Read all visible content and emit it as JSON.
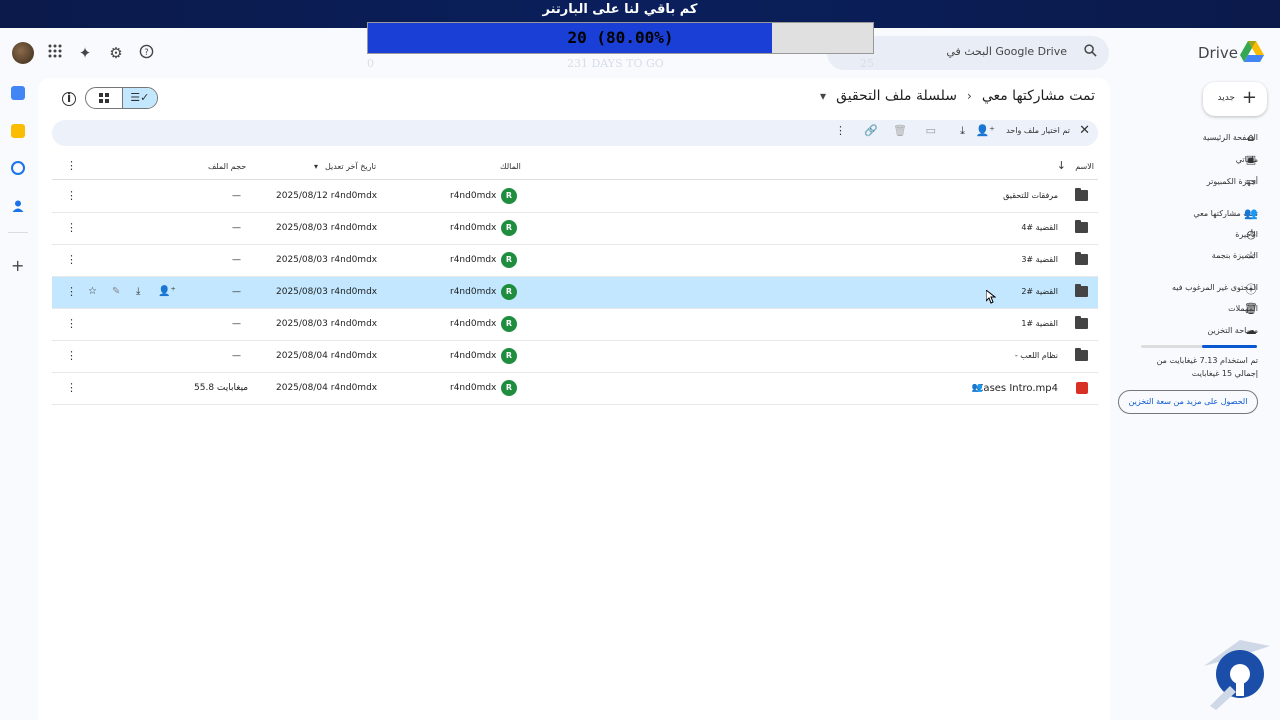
{
  "overlay": {
    "title": "كم باقي لنا على البارتنر",
    "progress_text": "20  (80.00%)",
    "progress_fraction": 0.8,
    "scale_min": "0",
    "scale_mid": "231 DAYS TO GO",
    "scale_max": "25"
  },
  "header": {
    "search_placeholder": "البحث في Google Drive",
    "brand": "Drive"
  },
  "breadcrumb": {
    "parent": "تمت مشاركتها معي",
    "current": "سلسلة ملف التحقيق"
  },
  "action_bar": {
    "selection_text": "تم اختيار ملف واحد"
  },
  "table": {
    "headers": {
      "name": "الاسم",
      "owner": "المالك",
      "modified": "تاريخ آخر تعديل",
      "size": "حجم الملف"
    },
    "rows": [
      {
        "name": "مرفقات للتحقيق",
        "owner": "r4nd0mdx",
        "initial": "R",
        "modified": "2025/08/12 r4nd0mdx",
        "size": "—"
      },
      {
        "name": "القضية #4",
        "owner": "r4nd0mdx",
        "initial": "R",
        "modified": "2025/08/03 r4nd0mdx",
        "size": "—"
      },
      {
        "name": "القضية #3",
        "owner": "r4nd0mdx",
        "initial": "R",
        "modified": "2025/08/03 r4nd0mdx",
        "size": "—"
      },
      {
        "name": "القضية #2",
        "owner": "r4nd0mdx",
        "initial": "R",
        "modified": "2025/08/03 r4nd0mdx",
        "size": "—"
      },
      {
        "name": "القضية #1",
        "owner": "r4nd0mdx",
        "initial": "R",
        "modified": "2025/08/03 r4nd0mdx",
        "size": "—"
      },
      {
        "name": "- نظام اللعب",
        "owner": "r4nd0mdx",
        "initial": "R",
        "modified": "2025/08/04 r4nd0mdx",
        "size": "—"
      },
      {
        "name": "Cases Intro.mp4",
        "owner": "r4nd0mdx",
        "initial": "R",
        "modified": "2025/08/04 r4nd0mdx",
        "size": "55.8 ميغابايت"
      }
    ]
  },
  "sidebar": {
    "new_label": "جديد",
    "items": [
      {
        "label": "الصفحة الرئيسية",
        "icon": "home-icon"
      },
      {
        "label": "ملفاتي",
        "icon": "my-drive-icon"
      },
      {
        "label": "أجهزة الكمبيوتر",
        "icon": "computer-icon"
      },
      {
        "label": "تمت مشاركتها معي",
        "icon": "shared-icon"
      },
      {
        "label": "الأخيرة",
        "icon": "clock-icon"
      },
      {
        "label": "المميزة بنجمة",
        "icon": "star-icon"
      },
      {
        "label": "المحتوى غير المرغوب فيه",
        "icon": "spam-icon"
      },
      {
        "label": "المهملات",
        "icon": "trash-icon"
      },
      {
        "label": "مساحة التخزين",
        "icon": "cloud-icon"
      }
    ],
    "storage_fraction": 0.475,
    "storage_text": "تم استخدام 7.13 غيغابايت من إجمالي 15 غيغابايت",
    "get_storage": "الحصول على مزيد من سعة التخزين"
  },
  "colors": {
    "accent": "#0b57d0",
    "selected_row": "#c2e7ff",
    "progress_fill": "#1a3fd6",
    "owner_avatar": "#1e8e3e"
  }
}
